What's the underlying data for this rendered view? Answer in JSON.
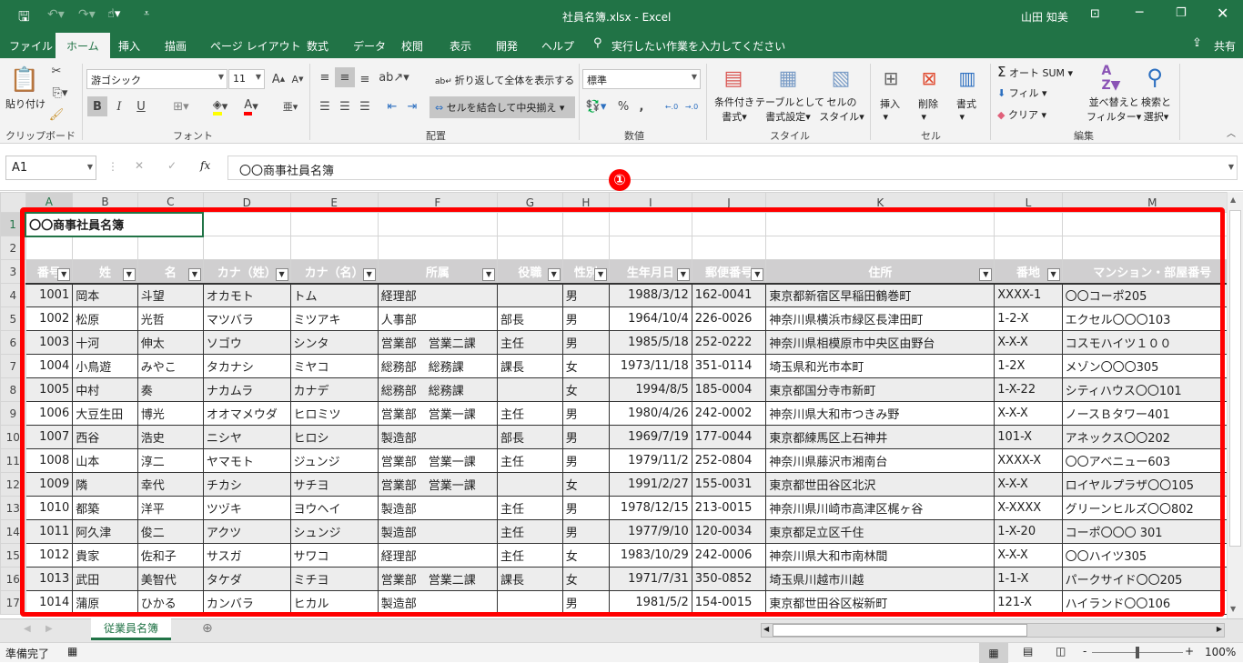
{
  "titlebar": {
    "title": "社員名簿.xlsx  -  Excel",
    "user": "山田 知美"
  },
  "tabs": [
    "ファイル",
    "ホーム",
    "挿入",
    "描画",
    "ページ レイアウト",
    "数式",
    "データ",
    "校閲",
    "表示",
    "開発",
    "ヘルプ"
  ],
  "tell_me": "実行したい作業を入力してください",
  "share": "共有",
  "ribbon": {
    "clipboard": {
      "paste": "貼り付け",
      "label": "クリップボード"
    },
    "font": {
      "name": "游ゴシック",
      "size": "11",
      "bold": "B",
      "italic": "I",
      "underline": "U",
      "label": "フォント",
      "fill_color": "#ffff00",
      "font_color": "#ff0000"
    },
    "alignment": {
      "wrap": "折り返して全体を表示する",
      "merge": "セルを結合して中央揃え",
      "label": "配置"
    },
    "number": {
      "format": "標準",
      "percent": "%",
      "comma": ",",
      "label": "数値"
    },
    "styles": {
      "conditional": "条件付き",
      "conditional2": "書式",
      "table": "テーブルとして",
      "table2": "書式設定",
      "cell": "セルの",
      "cell2": "スタイル",
      "label": "スタイル"
    },
    "cells": {
      "insert": "挿入",
      "delete": "削除",
      "format": "書式",
      "label": "セル"
    },
    "editing": {
      "autosum": "オート SUM",
      "fill": "フィル",
      "clear": "クリア",
      "sort": "並べ替えと",
      "sort2": "フィルター",
      "find": "検索と",
      "find2": "選択",
      "label": "編集"
    }
  },
  "formula": {
    "name_box": "A1",
    "fx": "fx",
    "content": "〇〇商事社員名簿"
  },
  "callout": "①",
  "columns": [
    "A",
    "B",
    "C",
    "D",
    "E",
    "F",
    "G",
    "H",
    "I",
    "J",
    "K",
    "L",
    "M"
  ],
  "sheet": {
    "title": "〇〇商事社員名簿",
    "headers": [
      "番号",
      "姓",
      "名",
      "カナ（姓）",
      "カナ（名）",
      "所属",
      "役職",
      "性別",
      "生年月日",
      "郵便番号",
      "住所",
      "番地",
      "マンション・部屋番号"
    ],
    "rows": [
      [
        "1001",
        "岡本",
        "斗望",
        "オカモト",
        "トム",
        "経理部",
        "",
        "男",
        "1988/3/12",
        "162-0041",
        "東京都新宿区早稲田鶴巻町",
        "XXXX-1",
        "〇〇コーポ205"
      ],
      [
        "1002",
        "松原",
        "光哲",
        "マツバラ",
        "ミツアキ",
        "人事部",
        "部長",
        "男",
        "1964/10/4",
        "226-0026",
        "神奈川県横浜市緑区長津田町",
        "1-2-X",
        "エクセル〇〇〇103"
      ],
      [
        "1003",
        "十河",
        "伸太",
        "ソゴウ",
        "シンタ",
        "営業部　営業二課",
        "主任",
        "男",
        "1985/5/18",
        "252-0222",
        "神奈川県相模原市中央区由野台",
        "X-X-X",
        "コスモハイツ１００"
      ],
      [
        "1004",
        "小鳥遊",
        "みやこ",
        "タカナシ",
        "ミヤコ",
        "総務部　総務課",
        "課長",
        "女",
        "1973/11/18",
        "351-0114",
        "埼玉県和光市本町",
        "1-2X",
        "メゾン〇〇〇305"
      ],
      [
        "1005",
        "中村",
        "奏",
        "ナカムラ",
        "カナデ",
        "総務部　総務課",
        "",
        "女",
        "1994/8/5",
        "185-0004",
        "東京都国分寺市新町",
        "1-X-22",
        "シティハウス〇〇101"
      ],
      [
        "1006",
        "大豆生田",
        "博光",
        "オオマメウダ",
        "ヒロミツ",
        "営業部　営業一課",
        "主任",
        "男",
        "1980/4/26",
        "242-0002",
        "神奈川県大和市つきみ野",
        "X-X-X",
        "ノースＢタワー401"
      ],
      [
        "1007",
        "西谷",
        "浩史",
        "ニシヤ",
        "ヒロシ",
        "製造部",
        "部長",
        "男",
        "1969/7/19",
        "177-0044",
        "東京都練馬区上石神井",
        "101-X",
        "アネックス〇〇202"
      ],
      [
        "1008",
        "山本",
        "淳二",
        "ヤマモト",
        "ジュンジ",
        "営業部　営業一課",
        "主任",
        "男",
        "1979/11/2",
        "252-0804",
        "神奈川県藤沢市湘南台",
        "XXXX-X",
        "〇〇アベニュー603"
      ],
      [
        "1009",
        "隣",
        "幸代",
        "チカシ",
        "サチヨ",
        "営業部　営業一課",
        "",
        "女",
        "1991/2/27",
        "155-0031",
        "東京都世田谷区北沢",
        "X-X-X",
        "ロイヤルプラザ〇〇105"
      ],
      [
        "1010",
        "都築",
        "洋平",
        "ツヅキ",
        "ヨウヘイ",
        "製造部",
        "主任",
        "男",
        "1978/12/15",
        "213-0015",
        "神奈川県川崎市高津区梶ヶ谷",
        "X-XXXX",
        "グリーンヒルズ〇〇802"
      ],
      [
        "1011",
        "阿久津",
        "俊二",
        "アクツ",
        "シュンジ",
        "製造部",
        "主任",
        "男",
        "1977/9/10",
        "120-0034",
        "東京都足立区千住",
        "1-X-20",
        "コーポ〇〇〇 301"
      ],
      [
        "1012",
        "貴家",
        "佐和子",
        "サスガ",
        "サワコ",
        "経理部",
        "主任",
        "女",
        "1983/10/29",
        "242-0006",
        "神奈川県大和市南林間",
        "X-X-X",
        "〇〇ハイツ305"
      ],
      [
        "1013",
        "武田",
        "美智代",
        "タケダ",
        "ミチヨ",
        "営業部　営業二課",
        "課長",
        "女",
        "1971/7/31",
        "350-0852",
        "埼玉県川越市川越",
        "1-1-X",
        "パークサイド〇〇205"
      ],
      [
        "1014",
        "蒲原",
        "ひかる",
        "カンバラ",
        "ヒカル",
        "製造部",
        "",
        "男",
        "1981/5/2",
        "154-0015",
        "東京都世田谷区桜新町",
        "121-X",
        "ハイランド〇〇106"
      ]
    ]
  },
  "sheet_tab": "従業員名簿",
  "status": {
    "ready": "準備完了",
    "zoom": "100%"
  },
  "colors": {
    "excel_green": "#217346",
    "highlight_red": "#ff0000"
  }
}
